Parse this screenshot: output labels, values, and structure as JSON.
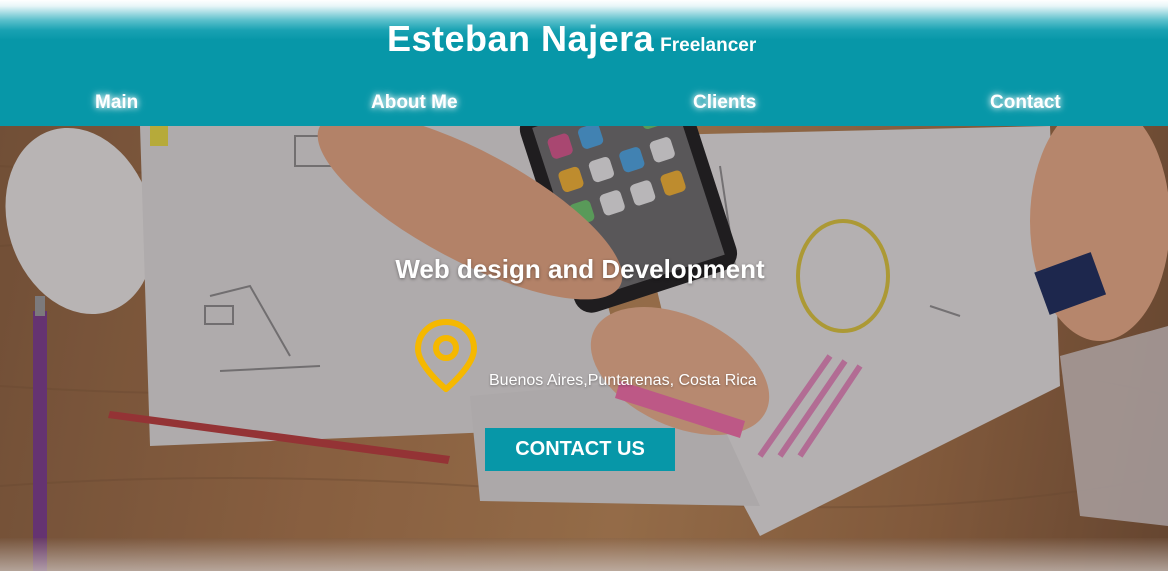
{
  "header": {
    "brand_name": "Esteban Najera",
    "brand_tagline": "Freelancer"
  },
  "nav": {
    "items": [
      {
        "label": "Main"
      },
      {
        "label": "About Me"
      },
      {
        "label": "Clients"
      },
      {
        "label": "Contact"
      }
    ]
  },
  "hero": {
    "title": "Web design and Development",
    "location_icon": "map-pin-icon",
    "location": "Buenos Aires,Puntarenas, Costa Rica",
    "cta_label": "CONTACT US"
  },
  "colors": {
    "primary": "#0797a8",
    "pin": "#f5b800",
    "text_on_primary": "#ffffff"
  }
}
